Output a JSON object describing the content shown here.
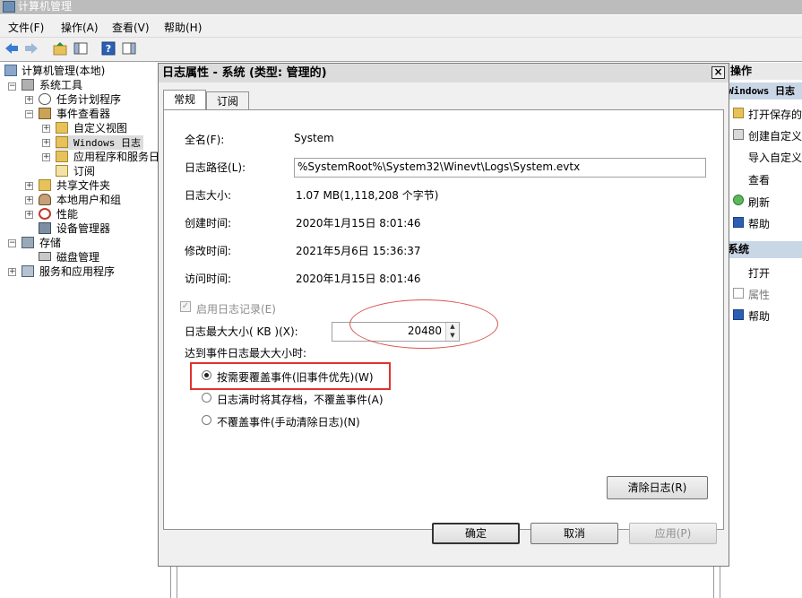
{
  "window": {
    "title": "计算机管理"
  },
  "menu": {
    "file": "文件(F)",
    "action": "操作(A)",
    "view": "查看(V)",
    "help": "帮助(H)"
  },
  "tree": {
    "root": "计算机管理(本地)",
    "system_tools": "系统工具",
    "task_scheduler": "任务计划程序",
    "event_viewer": "事件查看器",
    "custom_views": "自定义视图",
    "windows_logs": "Windows 日志",
    "app_service_logs": "应用程序和服务日",
    "subscriptions": "订阅",
    "shared_folders": "共享文件夹",
    "local_users": "本地用户和组",
    "performance": "性能",
    "device_manager": "设备管理器",
    "storage": "存储",
    "disk_management": "磁盘管理",
    "services_apps": "服务和应用程序"
  },
  "actions": {
    "header": "操作",
    "section1": "Windows 日志",
    "open_saved": "打开保存的",
    "create_custom": "创建自定义",
    "import_custom": "导入自定义",
    "view": "查看",
    "refresh": "刷新",
    "help": "帮助",
    "section2": "系统",
    "open": "打开",
    "properties": "属性",
    "help2": "帮助"
  },
  "dialog": {
    "title": "日志属性 - 系统 (类型: 管理的)",
    "tabs": {
      "general": "常规",
      "subscription": "订阅"
    },
    "fields": {
      "full_name_label": "全名(F):",
      "full_name_value": "System",
      "log_path_label": "日志路径(L):",
      "log_path_value": "%SystemRoot%\\System32\\Winevt\\Logs\\System.evtx",
      "log_size_label": "日志大小:",
      "log_size_value": "1.07 MB(1,118,208 个字节)",
      "created_label": "创建时间:",
      "created_value": "2020年1月15日 8:01:46",
      "modified_label": "修改时间:",
      "modified_value": "2021年5月6日 15:36:37",
      "accessed_label": "访问时间:",
      "accessed_value": "2020年1月15日 8:01:46"
    },
    "enable_logging": "启用日志记录(E)",
    "max_size_label": "日志最大大小( KB )(X):",
    "max_size_value": "20480",
    "when_max_label": "达到事件日志最大大小时:",
    "options": {
      "overwrite": "按需要覆盖事件(旧事件优先)(W)",
      "archive": "日志满时将其存档，不覆盖事件(A)",
      "no_overwrite": "不覆盖事件(手动清除日志)(N)"
    },
    "selected_option": "overwrite",
    "clear_log": "清除日志(R)",
    "ok": "确定",
    "cancel": "取消",
    "apply": "应用(P)"
  },
  "colors": {
    "highlight_red": "#e0312f",
    "selection_blue": "#3399ff"
  }
}
